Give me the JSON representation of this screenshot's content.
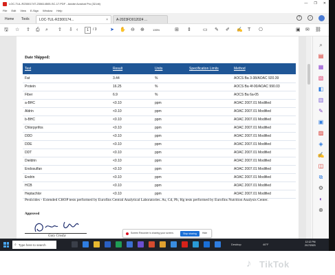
{
  "window": {
    "title": "LOC-TUL-R2300174T-230614505-SC-17.PDF - Adobe Acrobat Pro (32-bit)",
    "controls": [
      "—",
      "❐",
      "✕"
    ]
  },
  "menu": [
    "File",
    "Edit",
    "View",
    "E-Sign",
    "Window",
    "Help"
  ],
  "tabs": {
    "home": "Home",
    "tools": "Tools",
    "doc1": "LOC-TUL-R2300174...",
    "doc2": "A-2023FD012024 ..."
  },
  "toolbar": {
    "page_current": "1",
    "page_total": "/ 3",
    "zoom": "135%"
  },
  "document": {
    "date_shipped_label": "Date Shipped:",
    "columns": [
      "Test",
      "Result",
      "Units",
      "Specification Limits",
      "Method"
    ],
    "rows": [
      [
        "Fat",
        "3.44",
        "%",
        "",
        "AOCS Ba 3-38/AOAC 920.39"
      ],
      [
        "Protein",
        "16.25",
        "%",
        "",
        "AOCS Ba 4f-00/AOAC 990.03"
      ],
      [
        "Fiber",
        "6.9",
        "%",
        "",
        "AOCS Ba 6a-05"
      ],
      [
        "a-BHC",
        "<0.10",
        "ppm",
        "",
        "AOAC 2007.01 Modified"
      ],
      [
        "Aldrin",
        "<0.10",
        "ppm",
        "",
        "AOAC 2007.01 Modified"
      ],
      [
        "b-BHC",
        "<0.10",
        "ppm",
        "",
        "AOAC 2007.01 Modified"
      ],
      [
        "Chlorpyrifos",
        "<0.10",
        "ppm",
        "",
        "AOAC 2007.01 Modified"
      ],
      [
        "DDD",
        "<0.10",
        "ppm",
        "",
        "AOAC 2007.01 Modified"
      ],
      [
        "DDE",
        "<0.10",
        "ppm",
        "",
        "AOAC 2007.01 Modified"
      ],
      [
        "DDT",
        "<0.10",
        "ppm",
        "",
        "AOAC 2007.01 Modified"
      ],
      [
        "Dieldrin",
        "<0.10",
        "ppm",
        "",
        "AOAC 2007.01 Modified"
      ],
      [
        "Endosulfan",
        "<0.10",
        "ppm",
        "",
        "AOAC 2007.01 Modified"
      ],
      [
        "Endrin",
        "<0.10",
        "ppm",
        "",
        "AOAC 2007.01 Modified"
      ],
      [
        "HCB",
        "<0.10",
        "ppm",
        "",
        "AOAC 2007.01 Modified"
      ],
      [
        "Heptachlor",
        "<0.10",
        "ppm",
        "",
        "AOAC 2007.01 Modified"
      ]
    ],
    "note": "Pesticides - Extended CHOP tests performed by Eurofins Central Analytical Laboratories. As, Cd, Pb, Hg tests performed by Eurofins Nutrition Analysis Center.",
    "approved_label": "Approved",
    "signer": "Gary Crosby"
  },
  "recorder_toast": {
    "message": "Screen Recorder is sharing your screen.",
    "stop_label": "Stop sharing",
    "hide_label": "Hide"
  },
  "taskbar": {
    "search_placeholder": "Type here to search",
    "tray_label": "Desktop",
    "weather": "46°F",
    "time": "12:12 PM",
    "date": "2/17/2023"
  },
  "watermark": "TikTok",
  "colors": {
    "table_header_bg": "#1f5696",
    "taskbar_bg": "#1f2229",
    "accent": "#1a6fd6",
    "acrobat_red": "#d6221a"
  }
}
